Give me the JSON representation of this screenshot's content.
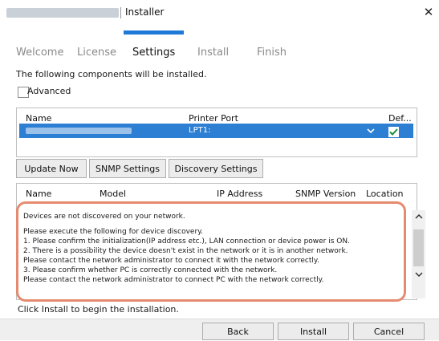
{
  "window": {
    "title": "Installer",
    "close_glyph": "✕"
  },
  "tabs": [
    {
      "label": "Welcome"
    },
    {
      "label": "License"
    },
    {
      "label": "Settings"
    },
    {
      "label": "Install"
    },
    {
      "label": "Finish"
    }
  ],
  "active_tab": "Settings",
  "intro_text": "The following components will be installed.",
  "advanced": {
    "label": "Advanced",
    "checked": false
  },
  "components_table": {
    "columns": [
      "Name",
      "Printer Port",
      "Def..."
    ],
    "rows": [
      {
        "port": "LPT1:",
        "default_checked": true
      }
    ]
  },
  "buttons": {
    "update_now": "Update Now",
    "snmp_settings": "SNMP Settings",
    "discovery_settings": "Discovery Settings"
  },
  "devices_table": {
    "columns": [
      "Name",
      "Model",
      "IP Address",
      "SNMP Version",
      "Location"
    ]
  },
  "message_lines": [
    "Devices are not discovered on your network.",
    "Please execute the following for device discovery.",
    "1. Please confirm the initialization(IP address etc.), LAN connection or device power is ON.",
    "2. There is a possibility the device doesn't exist in the network or it is in another network.",
    "Please contact the network administrator to connect it with the network correctly.",
    "3. Please confirm whether PC is correctly connected with the network.",
    "Please contact the network administrator to connect PC with the network correctly."
  ],
  "footer_text": "Click Install to begin the installation.",
  "footer_buttons": {
    "back": "Back",
    "install": "Install",
    "cancel": "Cancel"
  },
  "icons": {
    "dropdown": "chevron-down-icon",
    "checkbox_checked": "check-icon",
    "scroll_up": "chevron-up-icon",
    "scroll_down": "chevron-down-icon"
  },
  "colors": {
    "accent": "#1e7ad6",
    "selected_row": "#2d7fd3",
    "callout_border": "#e58b6f"
  }
}
